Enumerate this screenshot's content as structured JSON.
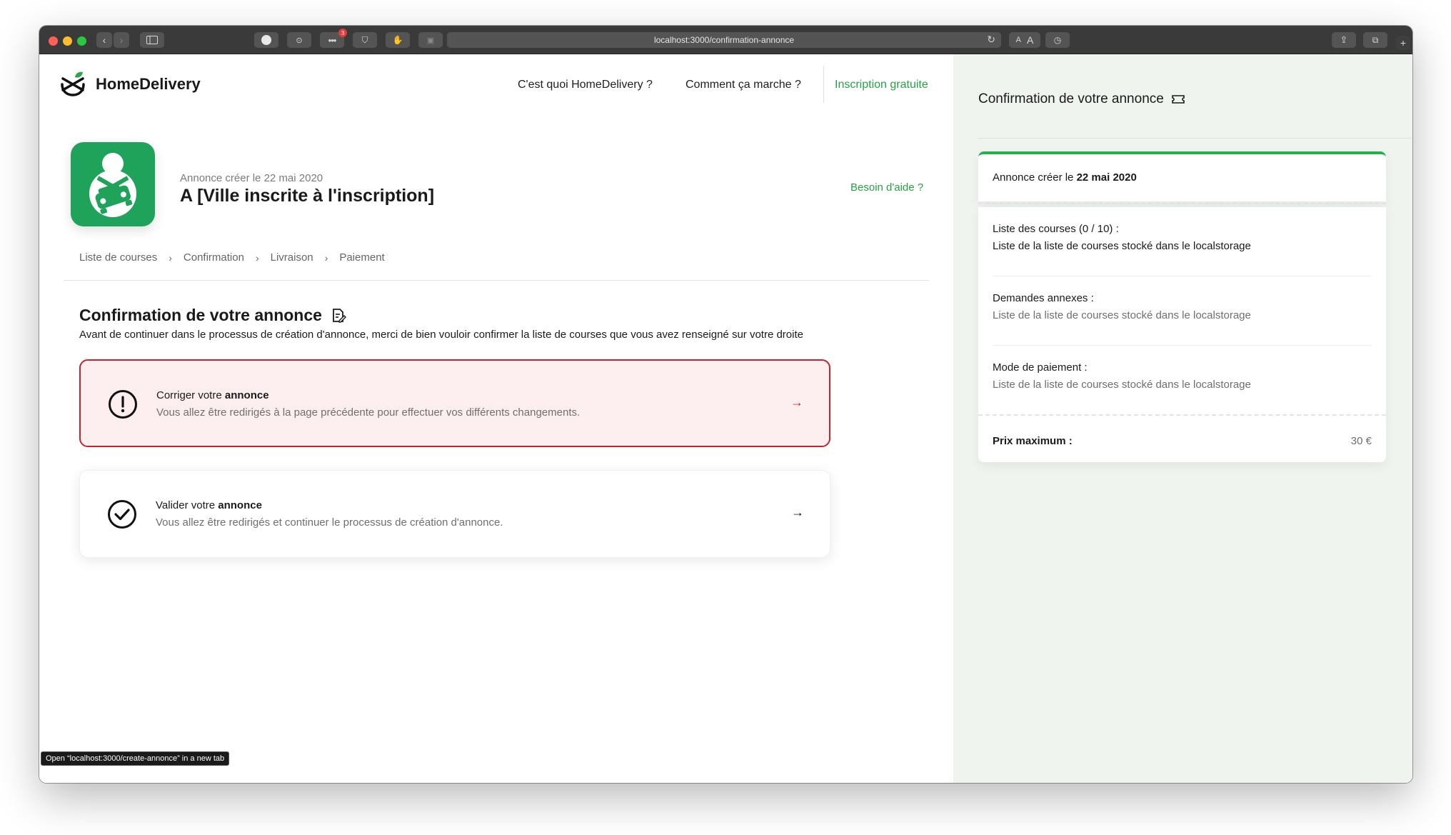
{
  "browser": {
    "url": "localhost:3000/confirmation-annonce",
    "text_size_small": "A",
    "text_size_large": "A",
    "extension_badge": "3",
    "status_bar": "Open “localhost:3000/create-annonce” in a new tab"
  },
  "header": {
    "brand": "HomeDelivery",
    "nav": [
      {
        "label": "C'est quoi HomeDelivery ?"
      },
      {
        "label": "Comment ça marche ?"
      },
      {
        "label": "Inscription gratuite"
      }
    ]
  },
  "annonce": {
    "date_label": "Annonce créer le 22 mai 2020",
    "title": "A [Ville inscrite à l'inscription]",
    "help": "Besoin d'aide ?"
  },
  "breadcrumb": [
    "Liste de courses",
    "Confirmation",
    "Livraison",
    "Paiement"
  ],
  "section": {
    "title": "Confirmation de votre annonce",
    "subtitle": "Avant de continuer dans le processus de création d'annonce, merci de bien vouloir confirmer la liste de courses que vous avez renseigné sur votre droite"
  },
  "cards": {
    "correct": {
      "title_prefix": "Corriger votre",
      "title_bold": "annonce",
      "desc": "Vous allez être redirigés à la page précédente pour effectuer vos différents changements."
    },
    "validate": {
      "title_prefix": "Valider votre",
      "title_bold": "annonce",
      "desc": "Vous allez être redirigés et continuer le processus de création d'annonce."
    }
  },
  "summary": {
    "title": "Confirmation de votre annonce",
    "created_prefix": "Annonce créer le",
    "created_date": "22 mai 2020",
    "items": [
      {
        "label": "Liste des courses (0 / 10) :",
        "value": "Liste de la liste de courses stocké dans le localstorage"
      },
      {
        "label": "Demandes annexes :",
        "value": "Liste de la liste de courses stocké dans le localstorage"
      },
      {
        "label": "Mode de paiement :",
        "value": "Liste de la liste de courses stocké dans le localstorage"
      }
    ],
    "max_price_label": "Prix maximum :",
    "max_price_value": "30 €"
  },
  "colors": {
    "accent_green": "#25a244",
    "app_icon_bg": "#1fa25a",
    "error_red": "#c0262d",
    "error_bg": "#fdeff0",
    "panel_bg": "#eff4ef"
  }
}
